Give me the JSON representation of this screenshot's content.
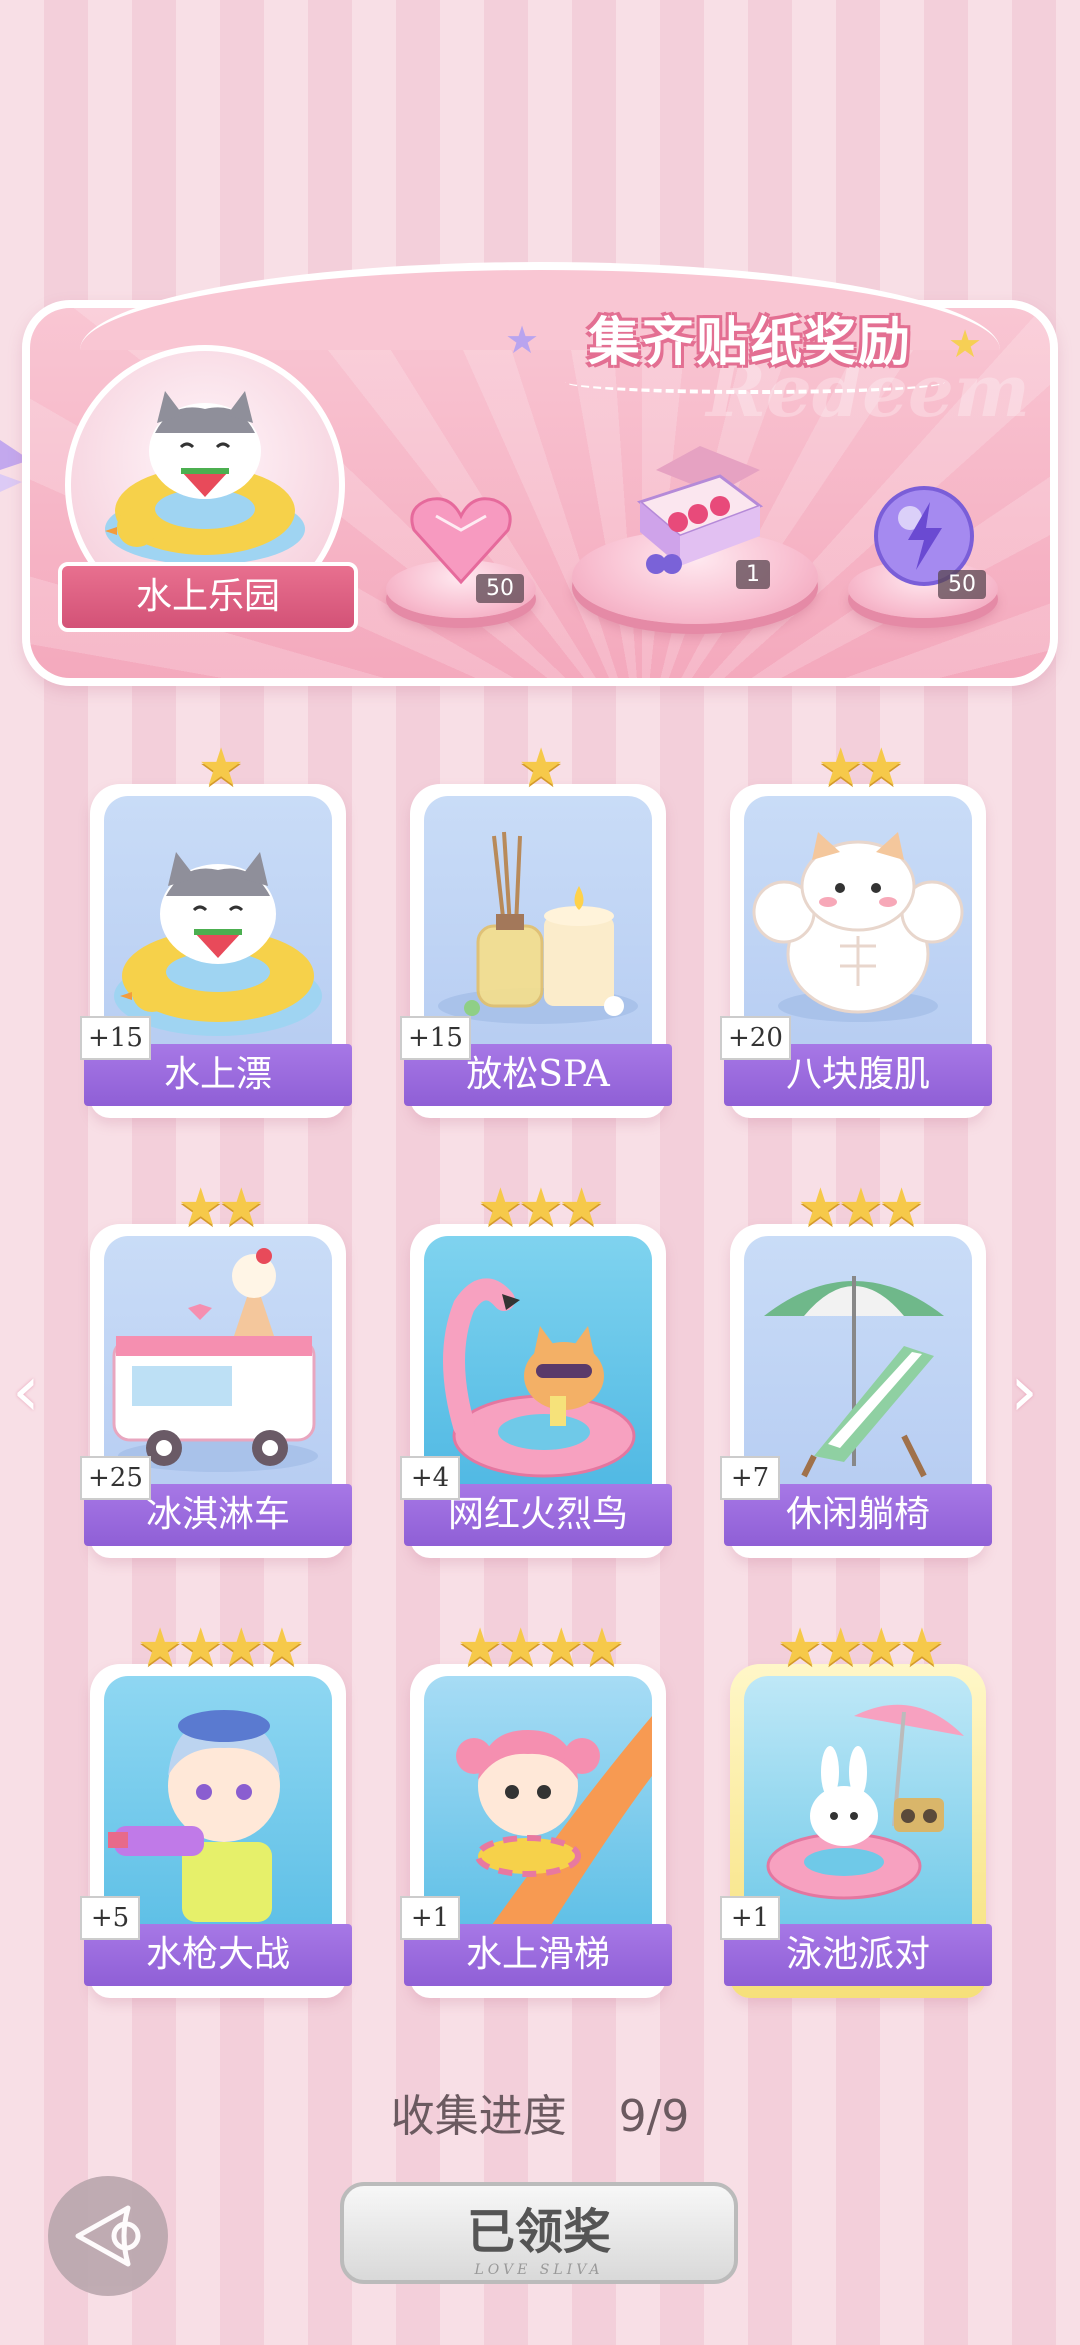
{
  "banner": {
    "title": "集齐贴纸奖励",
    "watermark": "Redeem",
    "album_name": "水上乐园",
    "rewards": [
      {
        "icon": "pink-heart-gem-icon",
        "count": "50"
      },
      {
        "icon": "gift-box-icon",
        "count": "1"
      },
      {
        "icon": "purple-energy-orb-icon",
        "count": "50"
      }
    ]
  },
  "cards": [
    {
      "name": "水上漂",
      "points": "+15",
      "stars": "★",
      "icon": "cat-swim-ring-icon"
    },
    {
      "name": "放松SPA",
      "points": "+15",
      "stars": "★",
      "icon": "aroma-candle-icon"
    },
    {
      "name": "八块腹肌",
      "points": "+20",
      "stars": "★★",
      "icon": "muscle-cat-icon"
    },
    {
      "name": "冰淇淋车",
      "points": "+25",
      "stars": "★★",
      "icon": "ice-cream-truck-icon"
    },
    {
      "name": "网红火烈鸟",
      "points": "+4",
      "stars": "★★★",
      "icon": "flamingo-float-icon"
    },
    {
      "name": "休闲躺椅",
      "points": "+7",
      "stars": "★★★",
      "icon": "beach-chair-icon"
    },
    {
      "name": "水枪大战",
      "points": "+5",
      "stars": "★★★★",
      "icon": "water-gun-boy-icon"
    },
    {
      "name": "水上滑梯",
      "points": "+1",
      "stars": "★★★★",
      "icon": "water-slide-girl-icon"
    },
    {
      "name": "泳池派对",
      "points": "+1",
      "stars": "★★★★",
      "icon": "pool-party-bunny-icon"
    }
  ],
  "footer": {
    "progress_label": "收集进度",
    "progress_value": "9/9",
    "claim_label": "已领奖",
    "claim_sub": "LOVE SLIVA"
  },
  "colors": {
    "label_purple": "#9a6ae0",
    "banner_pink": "#f4a9bd",
    "star_gold": "#f6c94a"
  }
}
